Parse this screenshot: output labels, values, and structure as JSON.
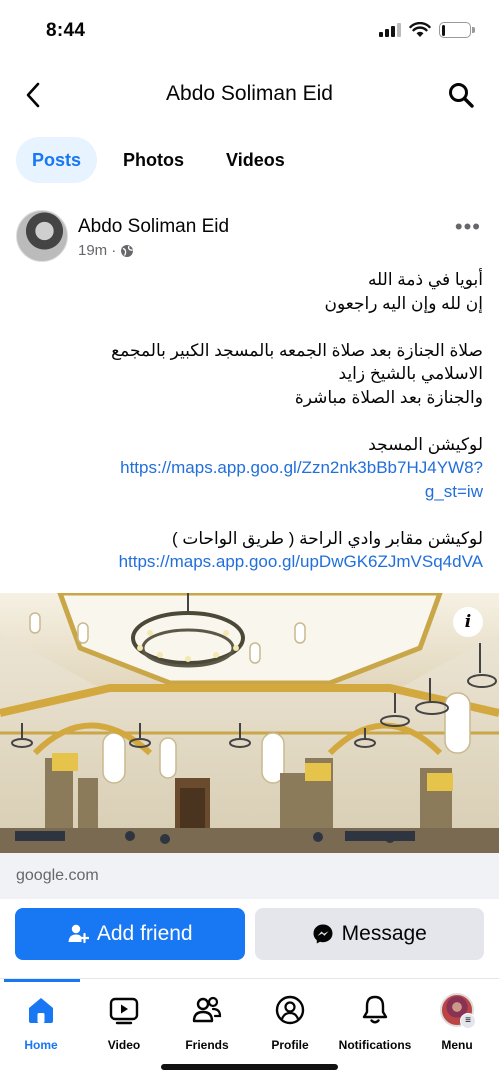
{
  "status_bar": {
    "time": "8:44",
    "battery_level": 0.12
  },
  "header": {
    "title": "Abdo Soliman Eid",
    "back_icon": "chevron-left-icon",
    "search_icon": "search-icon"
  },
  "tabs": [
    {
      "label": "Posts",
      "active": true
    },
    {
      "label": "Photos",
      "active": false
    },
    {
      "label": "Videos",
      "active": false
    }
  ],
  "post": {
    "author": "Abdo Soliman Eid",
    "time": "19m",
    "audience_icon": "globe-icon",
    "more_icon": "more-icon",
    "lines": [
      "أبويا في ذمة الله",
      "إن لله وإن اليه راجعون",
      "",
      "صلاة الجنازة بعد صلاة الجمعه بالمسجد الكبير بالمجمع",
      "الاسلامي بالشيخ زايد",
      "والجنازة بعد الصلاة مباشرة",
      "",
      "لوكيشن المسجد"
    ],
    "link1_part1": "https://maps.app.goo.gl/Zzn2nk3bBb7HJ4YW8?",
    "link1_part2": "g_st=iw",
    "line_cemetery": "لوكيشن مقابر وادي الراحة ( طريق الواحات )",
    "link2": "https://maps.app.goo.gl/upDwGK6ZJmVSq4dVA",
    "link_domain": "google.com",
    "info_icon": "info-icon"
  },
  "actions": {
    "add_friend": "Add friend",
    "message": "Message"
  },
  "bottom_nav": [
    {
      "label": "Home",
      "icon": "home-icon",
      "active": true
    },
    {
      "label": "Video",
      "icon": "video-icon",
      "active": false
    },
    {
      "label": "Friends",
      "icon": "friends-icon",
      "active": false
    },
    {
      "label": "Profile",
      "icon": "profile-icon",
      "active": false
    },
    {
      "label": "Notifications",
      "icon": "bell-icon",
      "active": false
    },
    {
      "label": "Menu",
      "icon": "menu-avatar-icon",
      "active": false
    }
  ],
  "colors": {
    "accent": "#1877f2",
    "link": "#216fdb",
    "secondary_text": "#65676b",
    "button_gray": "#e4e6eb"
  }
}
